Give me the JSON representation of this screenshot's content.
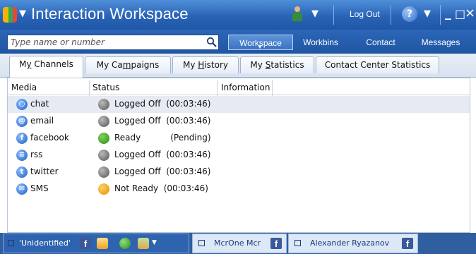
{
  "titlebar": {
    "app_title": "Interaction Workspace",
    "logout_label": "Log Out",
    "help_glyph": "?"
  },
  "search": {
    "placeholder": "Type name or number"
  },
  "nav": {
    "workspace": "Workspace",
    "workbins": "Workbins",
    "contact": "Contact",
    "messages": "Messages"
  },
  "tabs": {
    "my_channels": {
      "pre": "M",
      "ul": "y",
      "post": " Channels"
    },
    "my_campaigns": {
      "pre": "My Ca",
      "ul": "m",
      "post": "paigns"
    },
    "my_history": {
      "pre": "My ",
      "ul": "H",
      "post": "istory"
    },
    "my_statistics": {
      "pre": "My ",
      "ul": "S",
      "post": "tatistics"
    },
    "contact_center_statistics": {
      "label": "Contact Center Statistics"
    }
  },
  "columns": {
    "media": "Media",
    "status": "Status",
    "information": "Information"
  },
  "channels": [
    {
      "media": "chat",
      "status": "Logged Off  (00:03:46)",
      "state": "off",
      "glyph": "○"
    },
    {
      "media": "email",
      "status": "Logged Off  (00:03:46)",
      "state": "off",
      "glyph": "@"
    },
    {
      "media": "facebook",
      "status": "Ready           (Pending)",
      "state": "ready",
      "glyph": "f"
    },
    {
      "media": "rss",
      "status": "Logged Off  (00:03:46)",
      "state": "off",
      "glyph": "≡"
    },
    {
      "media": "twitter",
      "status": "Logged Off  (00:03:46)",
      "state": "off",
      "glyph": "t"
    },
    {
      "media": "SMS",
      "status": "Not Ready  (00:03:46)",
      "state": "not-ready",
      "glyph": "✉"
    }
  ],
  "interactions": [
    {
      "label": "'Unidentified'",
      "badge": "f"
    },
    {
      "label": "McrOne Mcr",
      "badge": "f"
    },
    {
      "label": "Alexander Ryazanov",
      "badge": "f"
    }
  ],
  "colors": {
    "titlebar": "#2a63b6",
    "navbar": "#1f56a2",
    "facebook": "#3b5998",
    "ready": "#2f8a1b",
    "not_ready": "#e39000",
    "logged_off": "#555555"
  }
}
